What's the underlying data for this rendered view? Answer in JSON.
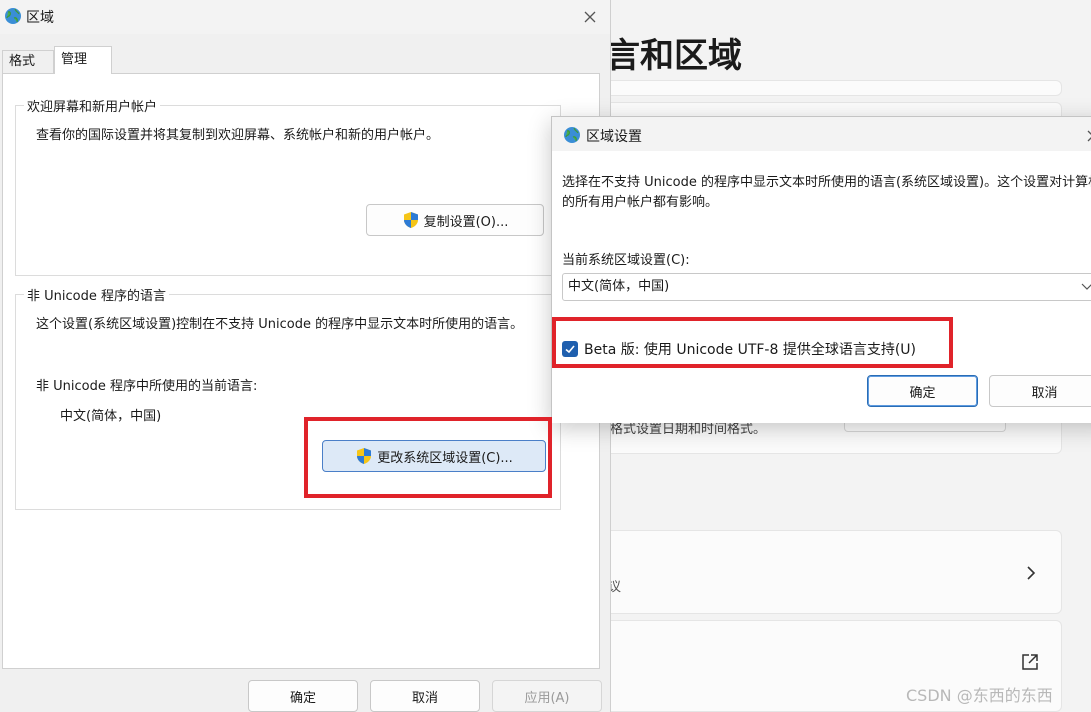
{
  "background_app": {
    "title": "言和区域",
    "format_text": "格式设置日期和时间格式。",
    "partial_text": "议",
    "watermark": "CSDN @东西的东西"
  },
  "region_dialog": {
    "title": "区域",
    "tabs": [
      {
        "label": "格式",
        "active": false
      },
      {
        "label": "管理",
        "active": true
      }
    ],
    "welcome_group": {
      "label": "欢迎屏幕和新用户帐户",
      "description": "查看你的国际设置并将其复制到欢迎屏幕、系统帐户和新的用户帐户。",
      "copy_button": "复制设置(O)..."
    },
    "non_unicode_group": {
      "label": "非 Unicode 程序的语言",
      "description": "这个设置(系统区域设置)控制在不支持 Unicode 的程序中显示文本时所使用的语言。",
      "current_label": "非 Unicode 程序中所使用的当前语言:",
      "current_value": "中文(简体，中国)",
      "change_button": "更改系统区域设置(C)..."
    },
    "buttons": {
      "ok": "确定",
      "cancel": "取消",
      "apply": "应用(A)"
    }
  },
  "region_settings_dialog": {
    "title": "区域设置",
    "description": "选择在不支持 Unicode 的程序中显示文本时所使用的语言(系统区域设置)。这个设置对计算机上的所有用户帐户都有影响。",
    "current_label": "当前系统区域设置(C):",
    "current_value": "中文(简体，中国)",
    "beta_checkbox": {
      "label": "Beta 版: 使用 Unicode UTF-8 提供全球语言支持(U)",
      "checked": true
    },
    "buttons": {
      "ok": "确定",
      "cancel": "取消"
    }
  },
  "colors": {
    "highlight": "#e0232a",
    "accent": "#1f5fae"
  }
}
